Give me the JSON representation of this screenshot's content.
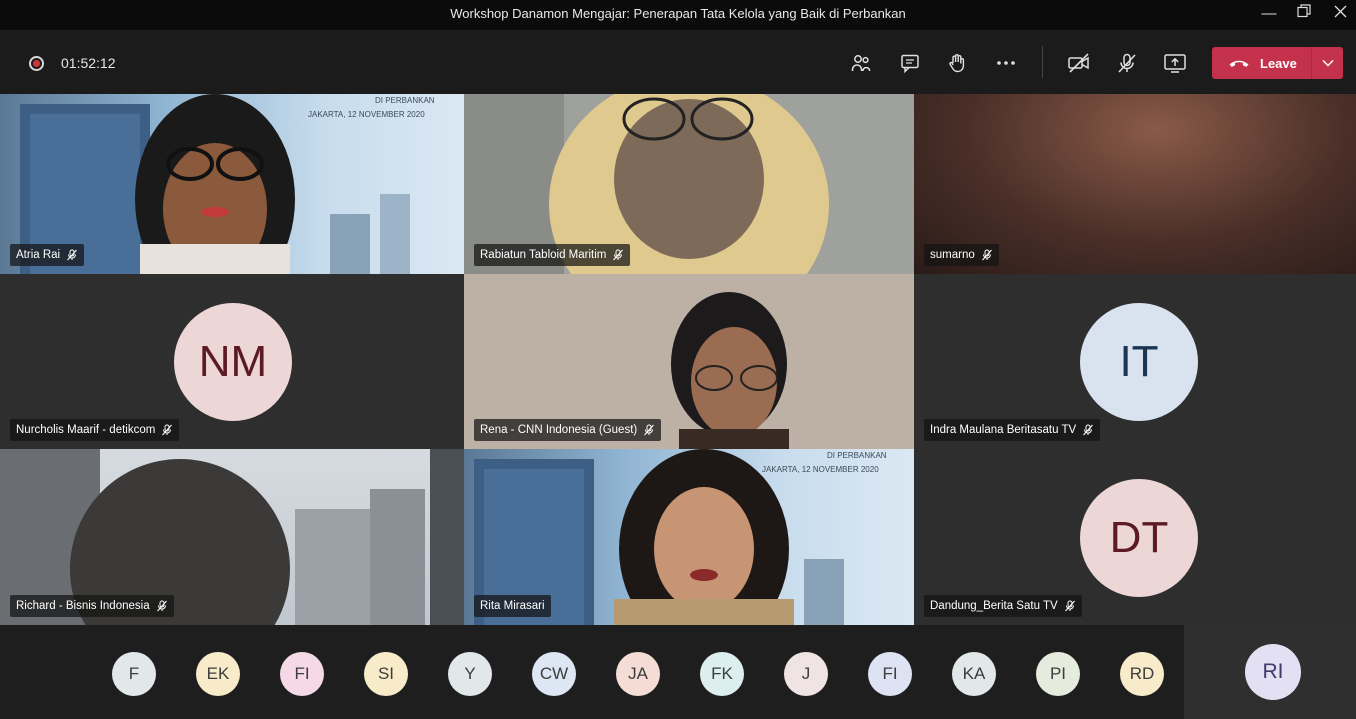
{
  "window": {
    "title": "Workshop Danamon Mengajar: Penerapan Tata Kelola yang Baik di Perbankan"
  },
  "toolbar": {
    "recording_time": "01:52:12",
    "leave_label": "Leave"
  },
  "slide_text": {
    "line1": "DI PERBANKAN",
    "line2": "JAKARTA, 12 NOVEMBER 2020"
  },
  "participants": [
    {
      "name": "Atria Rai"
    },
    {
      "name": "Rabiatun Tabloid Maritim"
    },
    {
      "name": "sumarno"
    },
    {
      "name": "Nurcholis Maarif - detikcom",
      "initials": "NM"
    },
    {
      "name": "Rena - CNN Indonesia (Guest)"
    },
    {
      "name": "Indra Maulana Beritasatu TV",
      "initials": "IT"
    },
    {
      "name": "Richard - Bisnis Indonesia"
    },
    {
      "name": "Rita Mirasari"
    },
    {
      "name": "Dandung_Berita Satu TV",
      "initials": "DT"
    }
  ],
  "overflow": [
    "F",
    "EK",
    "FI",
    "SI",
    "Y",
    "CW",
    "JA",
    "FK",
    "J",
    "FI",
    "KA",
    "PI",
    "RD"
  ],
  "self": {
    "initials": "RI"
  },
  "colors": {
    "leave": "#c4314b",
    "recording": "#d13438"
  }
}
